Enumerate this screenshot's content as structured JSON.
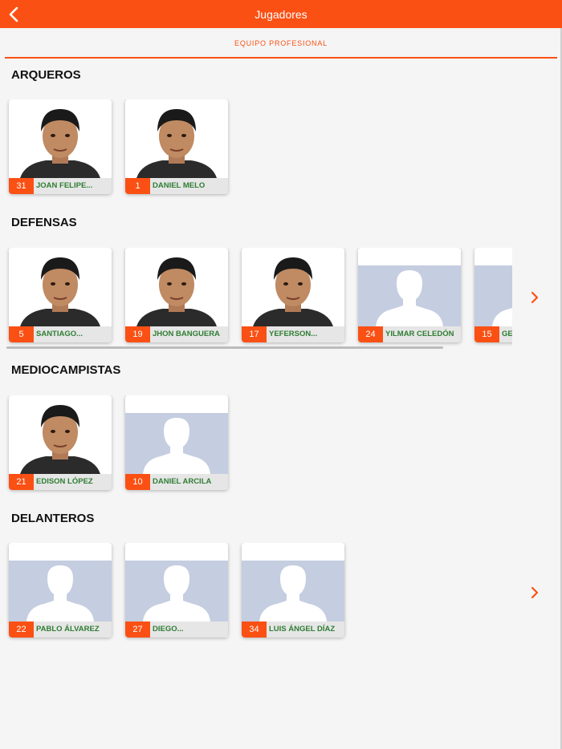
{
  "header": {
    "title": "Jugadores"
  },
  "tabs": {
    "active": "EQUIPO PROFESIONAL"
  },
  "colors": {
    "accent": "#fa5014",
    "name_text": "#2e7d32",
    "placeholder_bg": "#c5cde0"
  },
  "sections": [
    {
      "title": "ARQUEROS",
      "players": [
        {
          "number": "31",
          "name": "JOAN FELIPE...",
          "photo": "portrait"
        },
        {
          "number": "1",
          "name": "DANIEL MELO",
          "photo": "portrait"
        }
      ]
    },
    {
      "title": "DEFENSAS",
      "players": [
        {
          "number": "5",
          "name": "SANTIAGO...",
          "photo": "portrait"
        },
        {
          "number": "19",
          "name": "JHON BANGUERA",
          "photo": "portrait"
        },
        {
          "number": "17",
          "name": "YEFERSON...",
          "photo": "portrait"
        },
        {
          "number": "24",
          "name": "YILMAR CELEDÓN",
          "photo": "placeholder"
        },
        {
          "number": "15",
          "name": "GE",
          "photo": "placeholder"
        }
      ]
    },
    {
      "title": "MEDIOCAMPISTAS",
      "players": [
        {
          "number": "21",
          "name": "EDISON LÓPEZ",
          "photo": "portrait"
        },
        {
          "number": "10",
          "name": "DANIEL ARCILA",
          "photo": "placeholder"
        }
      ]
    },
    {
      "title": "DELANTEROS",
      "players": [
        {
          "number": "22",
          "name": "PABLO ÁLVAREZ",
          "photo": "placeholder"
        },
        {
          "number": "27",
          "name": "DIEGO...",
          "photo": "placeholder"
        },
        {
          "number": "34",
          "name": "LUIS ÁNGEL DÍAZ",
          "photo": "placeholder"
        }
      ]
    }
  ],
  "icons": {
    "back": "chevron-left-icon",
    "next": "chevron-right-icon",
    "placeholder": "person-silhouette-icon"
  }
}
